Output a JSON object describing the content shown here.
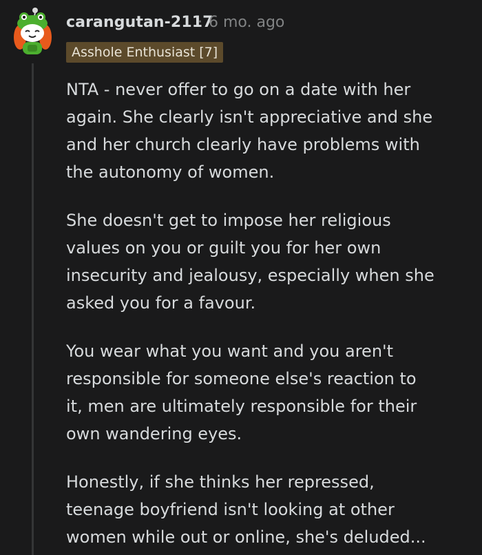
{
  "comment": {
    "username": "carangutan-2117",
    "separator": "·",
    "timestamp": "6 mo. ago",
    "flair": "Asshole Enthusiast [7]",
    "paragraphs": [
      [
        "NTA - never offer to go on a date with her",
        "again. She clearly isn't appreciative and she",
        "and her church clearly have problems with",
        "the autonomy of women."
      ],
      [
        "She doesn't get to impose her religious",
        "values on you or guilt you for her own",
        "insecurity and jealousy, especially when she",
        "asked you for a favour."
      ],
      [
        "You wear what you want and you aren't",
        "responsible for someone else's reaction to",
        "it, men are ultimately responsible for their",
        "own wandering eyes."
      ],
      [
        "Honestly, if she thinks her repressed,",
        "teenage boyfriend isn't looking at other",
        "women while out or online, she's deluded..."
      ]
    ]
  },
  "colors": {
    "background": "#1a1a1b",
    "text": "#d7dadc",
    "meta": "#818384",
    "flair_bg": "#5c4a2b",
    "thread_line": "#343536"
  },
  "icons": {
    "avatar": "snoo-avatar-green-frog-hat"
  }
}
